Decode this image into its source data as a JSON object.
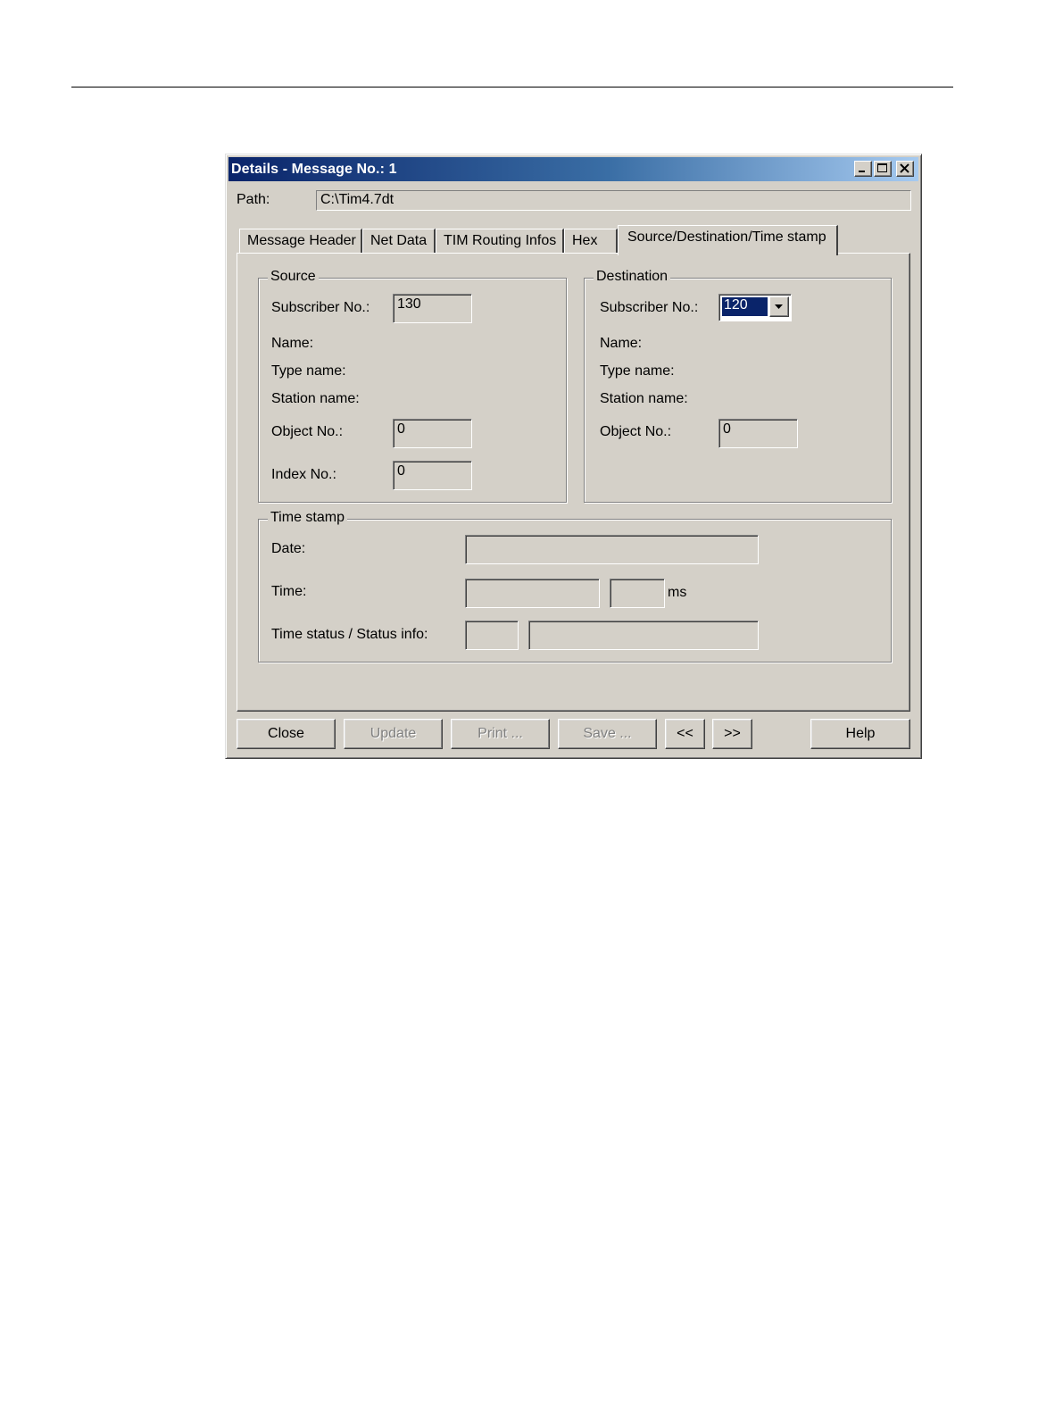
{
  "window": {
    "title": "Details - Message No.: 1"
  },
  "path": {
    "label": "Path:",
    "value": "C:\\Tim4.7dt"
  },
  "tabs": [
    {
      "label": "Message Header",
      "active": false
    },
    {
      "label": "Net Data",
      "active": false
    },
    {
      "label": "TIM Routing Infos",
      "active": false
    },
    {
      "label": "Hex",
      "active": false
    },
    {
      "label": "Source/Destination/Time stamp",
      "active": true
    }
  ],
  "source": {
    "title": "Source",
    "subscriber_label": "Subscriber No.:",
    "subscriber_value": "130",
    "name_label": "Name:",
    "type_label": "Type name:",
    "station_label": "Station name:",
    "object_label": "Object No.:",
    "object_value": "0",
    "index_label": "Index No.:",
    "index_value": "0"
  },
  "destination": {
    "title": "Destination",
    "subscriber_label": "Subscriber No.:",
    "subscriber_value": "120",
    "name_label": "Name:",
    "type_label": "Type name:",
    "station_label": "Station name:",
    "object_label": "Object No.:",
    "object_value": "0"
  },
  "timestamp": {
    "title": "Time stamp",
    "date_label": "Date:",
    "date_value": "",
    "time_label": "Time:",
    "time_value": "",
    "ms_value": "",
    "ms_unit": "ms",
    "status_label": "Time status / Status info:",
    "status_value": "",
    "status_info_value": ""
  },
  "buttons": {
    "close": "Close",
    "update": "Update",
    "print": "Print ...",
    "save": "Save ...",
    "prev": "<<",
    "next": ">>",
    "help": "Help"
  }
}
